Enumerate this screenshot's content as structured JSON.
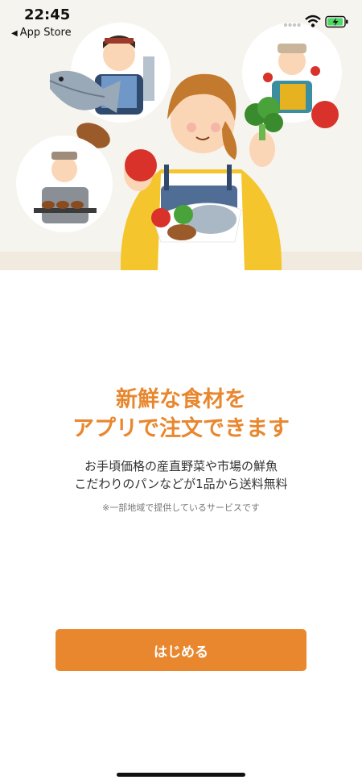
{
  "status_bar": {
    "time": "22:45",
    "back_label": "App Store",
    "icons": [
      "signal-dots-icon",
      "wifi-icon",
      "battery-charging-icon"
    ]
  },
  "hero": {
    "illustration": "people-with-fresh-food-illustration",
    "background_color": "#f6f4ee"
  },
  "headline": {
    "line1": "新鮮な食材を",
    "line2": "アプリで注文できます"
  },
  "description": {
    "line1": "お手頃価格の産直野菜や市場の鮮魚",
    "line2": "こだわりのパンなどが1品から送料無料"
  },
  "note": "※一部地域で提供しているサービスです",
  "start_button": {
    "label": "はじめる"
  },
  "colors": {
    "accent": "#e8872e",
    "text": "#333333",
    "note": "#777777"
  }
}
